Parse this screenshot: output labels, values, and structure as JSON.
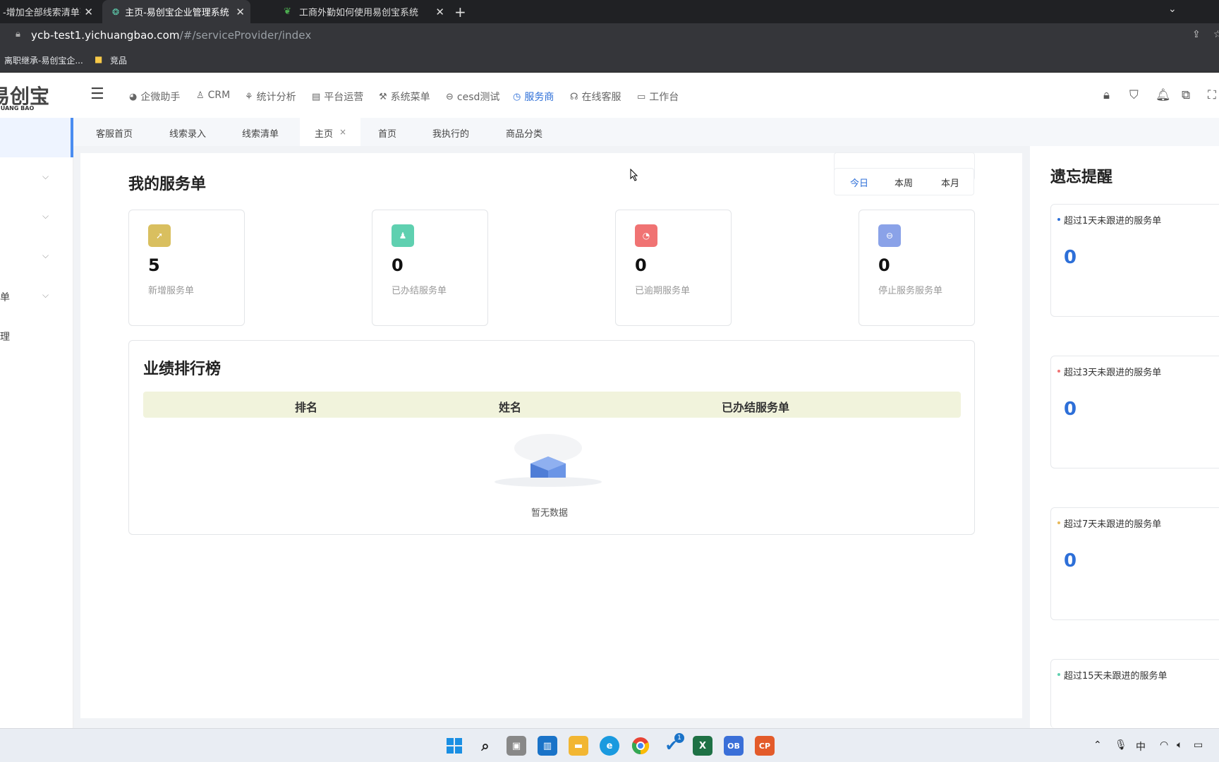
{
  "browser": {
    "tabs": [
      {
        "title": "-增加全部线索清单列表",
        "active": false
      },
      {
        "title": "主页-易创宝企业管理系统",
        "active": true
      },
      {
        "title": "工商外勤如何使用易创宝系统 · 语",
        "active": false
      }
    ],
    "new_tab": "+",
    "url_host": "ycb-test1.yichuangbao.com",
    "url_path": "/#/serviceProvider/index",
    "bookmarks": [
      "离职继承-易创宝企...",
      "竞品"
    ]
  },
  "app": {
    "logo_text": "易创宝",
    "logo_sub": "HUANG BAO",
    "nav": [
      {
        "label": "企微助手",
        "icon": "chat-icon",
        "active": false
      },
      {
        "label": "CRM",
        "icon": "user-icon",
        "active": false
      },
      {
        "label": "统计分析",
        "icon": "org-chart-icon",
        "active": false
      },
      {
        "label": "平台运营",
        "icon": "layout-icon",
        "active": false
      },
      {
        "label": "系统菜单",
        "icon": "wrench-icon",
        "active": false
      },
      {
        "label": "cesd测试",
        "icon": "circle-minus-icon",
        "active": false
      },
      {
        "label": "服务商",
        "icon": "clock-icon",
        "active": true
      },
      {
        "label": "在线客服",
        "icon": "headset-icon",
        "active": false
      },
      {
        "label": "工作台",
        "icon": "monitor-icon",
        "active": false
      }
    ],
    "sidebar_partial": [
      "单",
      "理"
    ],
    "tags": [
      {
        "label": "客服首页"
      },
      {
        "label": "线索录入"
      },
      {
        "label": "线索清单"
      },
      {
        "label": "主页",
        "active": true,
        "close": "×"
      },
      {
        "label": "首页"
      },
      {
        "label": "我执行的"
      },
      {
        "label": "商品分类"
      }
    ]
  },
  "service": {
    "title": "我的服务单",
    "periods": [
      {
        "label": "今日",
        "active": true
      },
      {
        "label": "本周",
        "active": false
      },
      {
        "label": "本月",
        "active": false
      }
    ],
    "cards": [
      {
        "value": "5",
        "label": "新增服务单",
        "color": "#d9bf5f",
        "icon": "arrow-up-icon"
      },
      {
        "value": "0",
        "label": "已办结服务单",
        "color": "#5fd0b0",
        "icon": "person-icon"
      },
      {
        "value": "0",
        "label": "已逾期服务单",
        "color": "#f07373",
        "icon": "clock-icon"
      },
      {
        "value": "0",
        "label": "停止服务服务单",
        "color": "#8aa2e8",
        "icon": "stop-icon"
      }
    ]
  },
  "ranking": {
    "title": "业绩排行榜",
    "columns": [
      "排名",
      "姓名",
      "已办结服务单"
    ],
    "empty_text": "暂无数据"
  },
  "reminders": {
    "title": "遗忘提醒",
    "items": [
      {
        "label": "超过1天未跟进的服务单",
        "value": "0",
        "dot": "#2d6fd8"
      },
      {
        "label": "超过3天未跟进的服务单",
        "value": "0",
        "dot": "#f07373"
      },
      {
        "label": "超过7天未跟进的服务单",
        "value": "0",
        "dot": "#e8b95a"
      },
      {
        "label": "超过15天未跟进的服务单",
        "value": "",
        "dot": "#5fd0b0"
      }
    ]
  },
  "taskbar": {
    "tray_ime": "中",
    "badge": "1"
  }
}
